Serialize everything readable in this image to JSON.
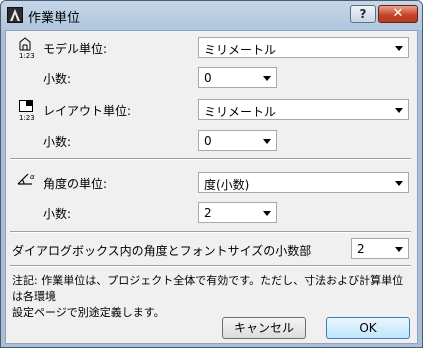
{
  "window": {
    "title": "作業単位",
    "help_label": "?",
    "close_label": "✕"
  },
  "model_unit": {
    "label": "モデル単位:",
    "value": "ミリメートル",
    "decimals_label": "小数:",
    "decimals_value": "0",
    "icon_scale": "1:23"
  },
  "layout_unit": {
    "label": "レイアウト単位:",
    "value": "ミリメートル",
    "decimals_label": "小数:",
    "decimals_value": "0",
    "icon_scale": "1:23"
  },
  "angle_unit": {
    "label": "角度の単位:",
    "value": "度(小数)",
    "decimals_label": "小数:",
    "decimals_value": "2"
  },
  "dialog_angle": {
    "label": "ダイアログボックス内の角度とフォントサイズの小数部",
    "value": "2"
  },
  "note": {
    "line1": "注記: 作業単位は、プロジェクト全体で有効です。ただし、寸法および計算単位は各環境",
    "line2": "設定ページで別途定義します。"
  },
  "buttons": {
    "cancel": "キャンセル",
    "ok": "OK"
  }
}
